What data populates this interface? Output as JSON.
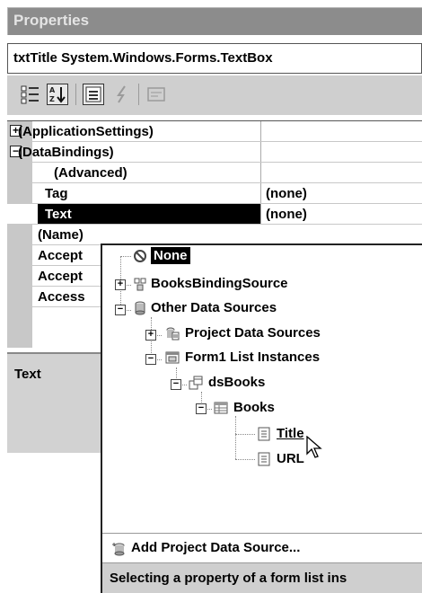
{
  "window": {
    "title": "Properties",
    "object_selector": "txtTitle  System.Windows.Forms.TextBox"
  },
  "toolbar": {
    "buttons": [
      "categorized-icon",
      "alphabetical-icon",
      "properties-icon",
      "events-icon",
      "property-pages-icon"
    ]
  },
  "grid": {
    "rows": [
      {
        "name": "(ApplicationSettings)",
        "value": "",
        "expander": "+"
      },
      {
        "name": "(DataBindings)",
        "value": "",
        "expander": "−"
      },
      {
        "name": "(Advanced)",
        "value": ""
      },
      {
        "name": "Tag",
        "value": "(none)"
      },
      {
        "name": "Text",
        "value": "(none)",
        "selected": true
      },
      {
        "name": "(Name)",
        "value": ""
      },
      {
        "name": "Accept",
        "value": ""
      },
      {
        "name": "Accept",
        "value": ""
      },
      {
        "name": "Access",
        "value": ""
      }
    ]
  },
  "description": {
    "title": "Text"
  },
  "popup": {
    "tree": {
      "none": "None",
      "books_binding_source": "BooksBindingSource",
      "other_data_sources": "Other Data Sources",
      "project_data_sources": "Project Data Sources",
      "form1_list_instances": "Form1 List Instances",
      "dsbooks": "dsBooks",
      "books": "Books",
      "title": "Title",
      "url": "URL"
    },
    "add_source_label": "Add Project Data Source...",
    "status_text": "Selecting a property of a form list ins"
  },
  "colors": {
    "title_bar": "#8c8c8c",
    "selection": "#000000",
    "gutter": "#c8c8c8",
    "toolbar": "#cfcfcf"
  }
}
